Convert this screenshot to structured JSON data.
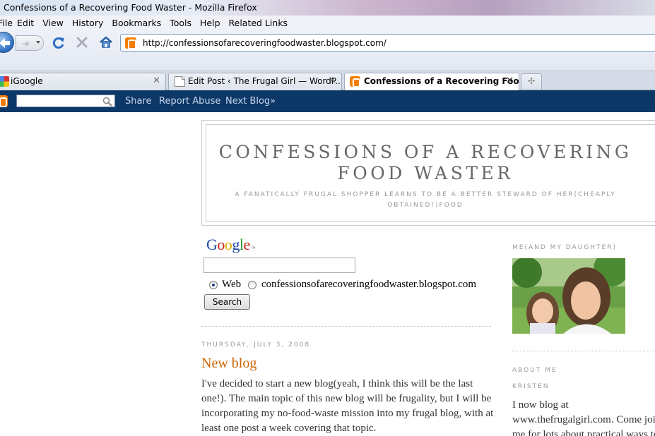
{
  "window": {
    "title": "Confessions of a Recovering Food Waster - Mozilla Firefox"
  },
  "menu": {
    "items": [
      "File",
      "Edit",
      "View",
      "History",
      "Bookmarks",
      "Tools",
      "Help",
      "Related Links"
    ]
  },
  "navbar": {
    "url": "http://confessionsofarecoveringfoodwaster.blogspot.com/"
  },
  "tabs": [
    {
      "label": "iGoogle",
      "icon": "igoogle-icon",
      "active": false
    },
    {
      "label": "Edit Post ‹ The Frugal Girl — WordP...",
      "icon": "page-icon",
      "active": false
    },
    {
      "label": "Confessions of a Recovering Food...",
      "icon": "blogger-icon",
      "active": true
    }
  ],
  "blogger_nav": {
    "share": "Share",
    "report": "Report Abuse",
    "next": "Next Blog»"
  },
  "blog": {
    "title": "Confessions of a Recovering Food Waster",
    "description": "A fanatically frugal shopper learns to be a better steward of her(cheaply obtained!)food"
  },
  "google_search": {
    "option_web": "Web",
    "option_site": "confessionsofarecoveringfoodwaster.blogspot.com",
    "button": "Search"
  },
  "post": {
    "date": "Thursday, July 3, 2008",
    "title": "New blog",
    "body": "I've decided to start a new blog(yeah, I think this will be the last one!). The main topic of this new blog will be frugality, but I will be incorporating my no-food-waste mission into my frugal blog, with at least one post a week covering that topic."
  },
  "sidebar": {
    "photo_heading": "Me(and my daughter)",
    "about_heading": "About Me",
    "author_name": "Kristen",
    "about_line1": "I now blog at",
    "about_line2": "www.thefrugalgirl.com. Come join",
    "about_line3": "me for lots about practical ways to"
  },
  "colors": {
    "blogger_nav": "#0d3767",
    "post_title": "#cc6600",
    "blogger_orange": "#f57d00"
  }
}
